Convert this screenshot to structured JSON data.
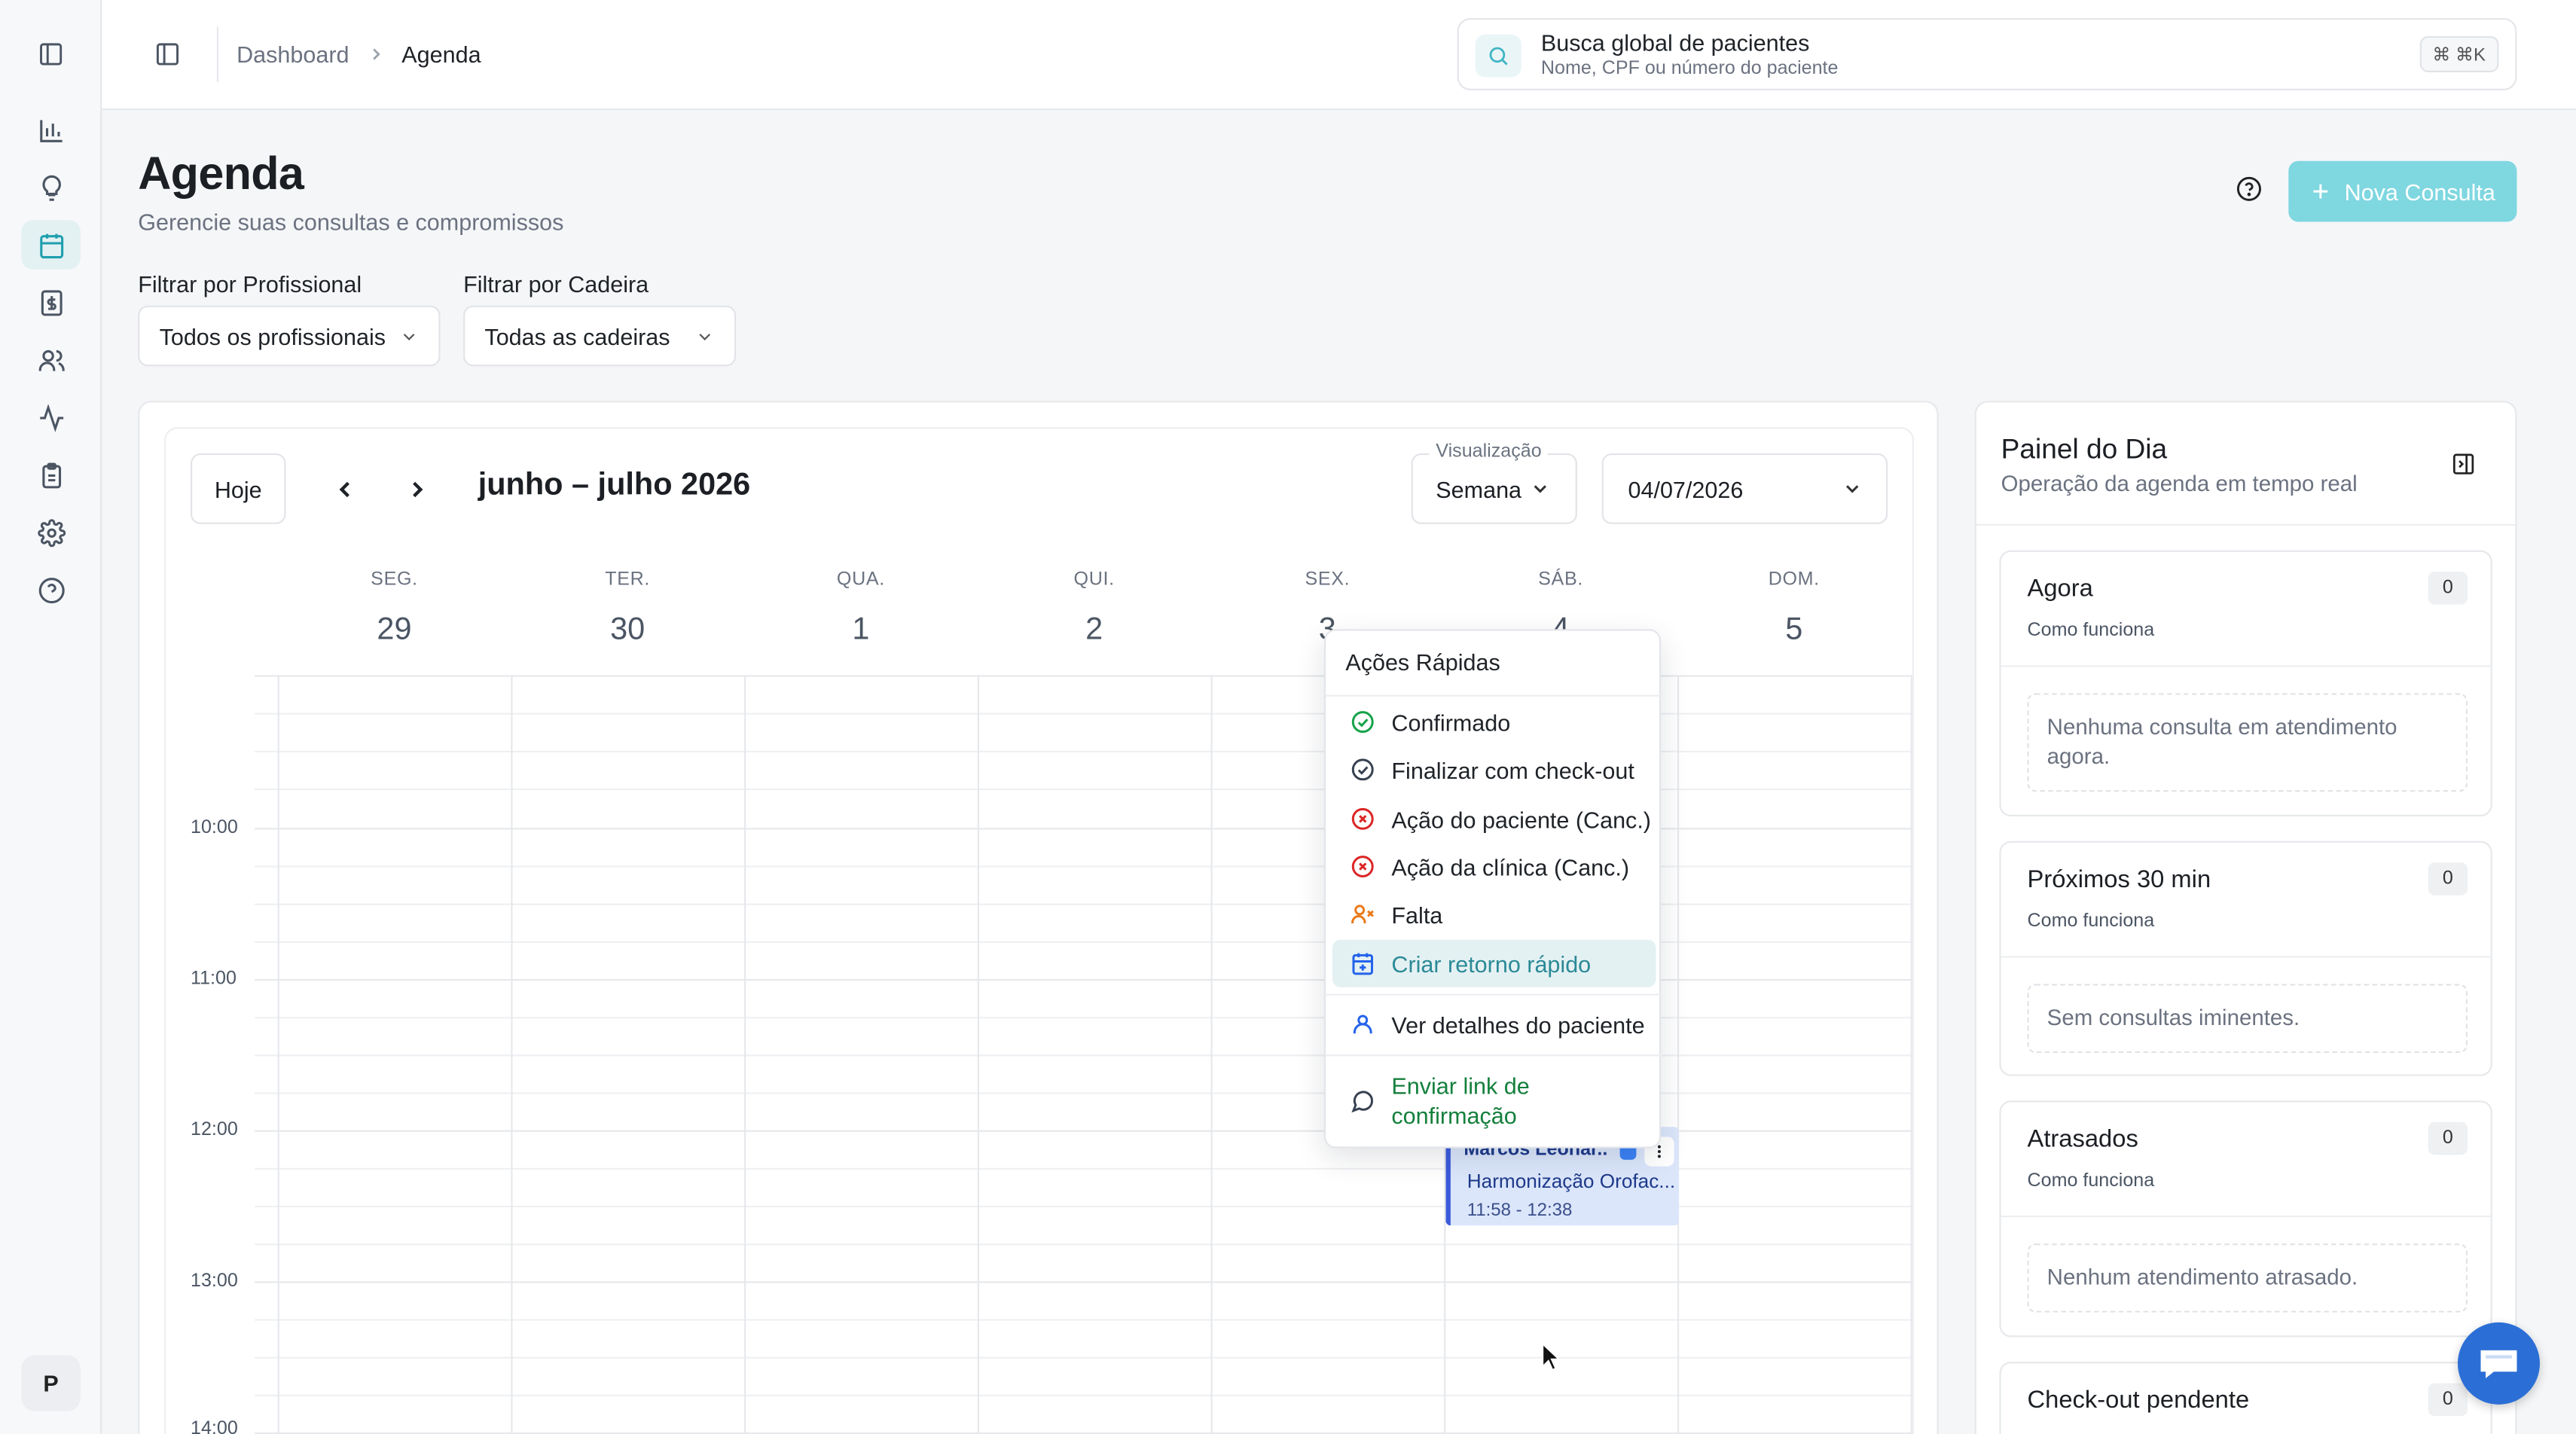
{
  "breadcrumb": {
    "home": "Dashboard",
    "current": "Agenda"
  },
  "search": {
    "title": "Busca global de pacientes",
    "hint": "Nome, CPF ou número do paciente",
    "shortcut": "⌘ ⌘K"
  },
  "page": {
    "title": "Agenda",
    "subtitle": "Gerencie suas consultas e compromissos",
    "new_button": "Nova Consulta"
  },
  "filters": {
    "professional": {
      "label": "Filtrar por Profissional",
      "value": "Todos os profissionais"
    },
    "chair": {
      "label": "Filtrar por Cadeira",
      "value": "Todas as cadeiras"
    }
  },
  "calendar": {
    "today_button": "Hoje",
    "range_title": "junho – julho 2026",
    "view": {
      "label": "Visualização",
      "value": "Semana"
    },
    "date": "04/07/2026",
    "days": [
      {
        "name": "SEG.",
        "num": "29"
      },
      {
        "name": "TER.",
        "num": "30"
      },
      {
        "name": "QUA.",
        "num": "1"
      },
      {
        "name": "QUI.",
        "num": "2"
      },
      {
        "name": "SEX.",
        "num": "3"
      },
      {
        "name": "SÁB.",
        "num": "4"
      },
      {
        "name": "DOM.",
        "num": "5"
      }
    ],
    "times": [
      "10:00",
      "11:00",
      "12:00",
      "13:00",
      "14:00"
    ],
    "appointment": {
      "patient": "Marcos Leonar...",
      "procedure": "Harmonização Orofac...",
      "time": "11:58 - 12:38"
    }
  },
  "quick_actions": {
    "title": "Ações Rápidas",
    "items": [
      {
        "label": "Confirmado",
        "icon": "check-circle-icon",
        "color": "#16a34a"
      },
      {
        "label": "Finalizar com check-out",
        "icon": "check-circle-icon",
        "color": "#374151"
      },
      {
        "label": "Ação do paciente (Canc.)",
        "icon": "x-circle-icon",
        "color": "#dc2626"
      },
      {
        "label": "Ação da clínica (Canc.)",
        "icon": "x-circle-icon",
        "color": "#dc2626"
      },
      {
        "label": "Falta",
        "icon": "user-x-icon",
        "color": "#ea7a1a"
      },
      {
        "label": "Criar retorno rápido",
        "icon": "calendar-plus-icon",
        "color": "#2563eb"
      },
      {
        "label": "Ver detalhes do paciente",
        "icon": "user-icon",
        "color": "#2563eb"
      },
      {
        "label": "Enviar link de confirmação",
        "icon": "message-circle-icon",
        "color": "#15803d"
      }
    ]
  },
  "day_panel": {
    "title": "Painel do Dia",
    "subtitle": "Operação da agenda em tempo real",
    "how_label": "Como funciona",
    "sections": [
      {
        "title": "Agora",
        "count": "0",
        "empty": "Nenhuma consulta em atendimento agora."
      },
      {
        "title": "Próximos 30 min",
        "count": "0",
        "empty": "Sem consultas iminentes."
      },
      {
        "title": "Atrasados",
        "count": "0",
        "empty": "Nenhum atendimento atrasado."
      },
      {
        "title": "Check-out pendente",
        "count": "0"
      }
    ]
  },
  "user": {
    "initial": "P"
  },
  "colors": {
    "accent": "#1f9fae",
    "primary_button": "#7fd7e0",
    "appointment": "#dbe6fb",
    "chat": "#2b6fd6"
  }
}
